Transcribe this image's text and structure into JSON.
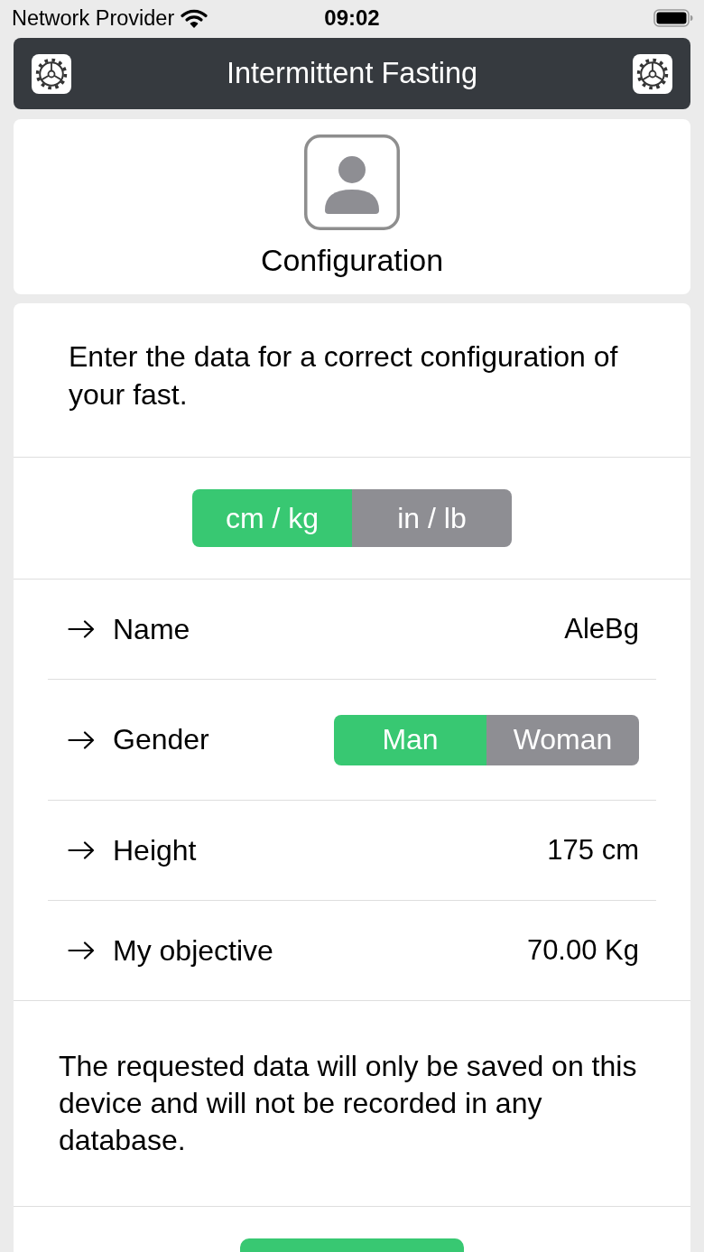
{
  "status_bar": {
    "carrier": "Network Provider",
    "time": "09:02"
  },
  "header": {
    "title": "Intermittent Fasting"
  },
  "profile": {
    "title": "Configuration"
  },
  "intro": "Enter the data for a correct configuration of your fast.",
  "units": [
    {
      "label": "cm / kg",
      "selected": true
    },
    {
      "label": "in / lb",
      "selected": false
    }
  ],
  "fields": [
    {
      "kind": "value",
      "label": "Name",
      "value": "AleBg"
    },
    {
      "kind": "choice",
      "label": "Gender",
      "options": [
        {
          "label": "Man",
          "selected": true
        },
        {
          "label": "Woman",
          "selected": false
        }
      ]
    },
    {
      "kind": "value",
      "label": "Height",
      "value": "175 cm"
    },
    {
      "kind": "value",
      "label": "My objective",
      "value": "70.00 Kg"
    }
  ],
  "note": "The requested data will only be saved on this device and will not be recorded in any database."
}
